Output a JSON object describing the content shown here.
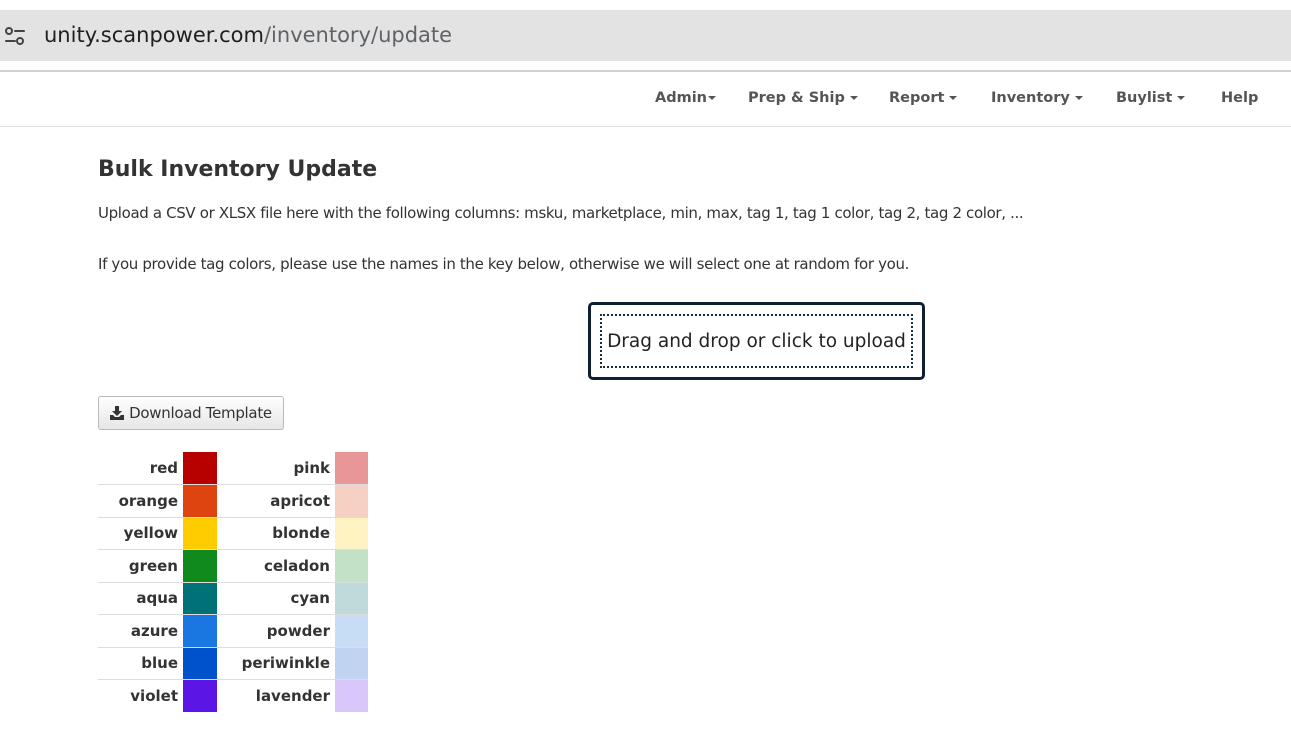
{
  "browser": {
    "url_host": "unity.scanpower.com",
    "url_path": "/inventory/update"
  },
  "navbar": {
    "items": [
      {
        "label": "Admin",
        "dropdown": true
      },
      {
        "label": "Prep & Ship",
        "dropdown": true
      },
      {
        "label": "Report",
        "dropdown": true
      },
      {
        "label": "Inventory",
        "dropdown": true
      },
      {
        "label": "Buylist",
        "dropdown": true
      },
      {
        "label": "Help",
        "dropdown": false
      }
    ]
  },
  "page": {
    "title": "Bulk Inventory Update",
    "instructions": "Upload a CSV or XLSX file here with the following columns: msku, marketplace, min, max, tag 1, tag 1 color, tag 2, tag 2 color, ...",
    "tag_note": "If you provide tag colors, please use the names in the key below, otherwise we will select one at random for you.",
    "upload_label": "Drag and drop or click to upload",
    "download_label": "Download Template"
  },
  "icons": {
    "site_info": "tune-icon",
    "download": "download-icon",
    "caret": "caret-down-icon"
  },
  "color_key": [
    {
      "left": {
        "name": "red",
        "color": "#b70000"
      },
      "right": {
        "name": "pink",
        "color": "#e99696"
      }
    },
    {
      "left": {
        "name": "orange",
        "color": "#dd4410"
      },
      "right": {
        "name": "apricot",
        "color": "#f6d0c3"
      }
    },
    {
      "left": {
        "name": "yellow",
        "color": "#ffcc00"
      },
      "right": {
        "name": "blonde",
        "color": "#fff3c1"
      }
    },
    {
      "left": {
        "name": "green",
        "color": "#118a1d"
      },
      "right": {
        "name": "celadon",
        "color": "#c3e1c6"
      }
    },
    {
      "left": {
        "name": "aqua",
        "color": "#007177"
      },
      "right": {
        "name": "cyan",
        "color": "#bedada"
      }
    },
    {
      "left": {
        "name": "azure",
        "color": "#1a76e0"
      },
      "right": {
        "name": "powder",
        "color": "#c7ddf6"
      }
    },
    {
      "left": {
        "name": "blue",
        "color": "#0052cc"
      },
      "right": {
        "name": "periwinkle",
        "color": "#c0d4f2"
      }
    },
    {
      "left": {
        "name": "violet",
        "color": "#5b16e5"
      },
      "right": {
        "name": "lavender",
        "color": "#d8c7f8"
      }
    }
  ]
}
